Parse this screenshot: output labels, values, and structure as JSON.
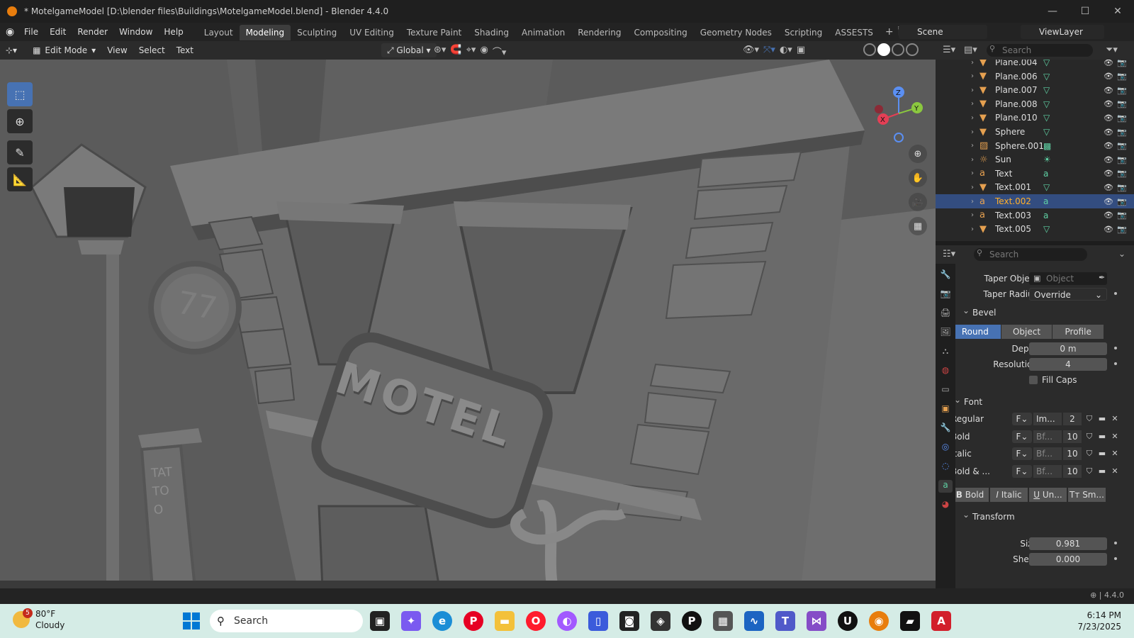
{
  "window": {
    "title": "* MotelgameModel [D:\\blender files\\Buildings\\MotelgameModel.blend] - Blender 4.4.0",
    "min": "—",
    "max": "☐",
    "close": "✕"
  },
  "menu": [
    "File",
    "Edit",
    "Render",
    "Window",
    "Help"
  ],
  "workspaces": [
    "Layout",
    "Modeling",
    "Sculpting",
    "UV Editing",
    "Texture Paint",
    "Shading",
    "Animation",
    "Rendering",
    "Compositing",
    "Geometry Nodes",
    "Scripting",
    "ASSESTS"
  ],
  "scene": "Scene",
  "viewlayer": "ViewLayer",
  "viewport_header": {
    "mode": "Edit Mode",
    "items": [
      "View",
      "Select",
      "Text"
    ],
    "orientation": "Global"
  },
  "outliner": {
    "search_placeholder": "Search",
    "rows": [
      {
        "name": "Plane.004",
        "icon": "mesh"
      },
      {
        "name": "Plane.006",
        "icon": "mesh"
      },
      {
        "name": "Plane.007",
        "icon": "mesh"
      },
      {
        "name": "Plane.008",
        "icon": "mesh"
      },
      {
        "name": "Plane.010",
        "icon": "mesh"
      },
      {
        "name": "Sphere",
        "icon": "mesh"
      },
      {
        "name": "Sphere.001",
        "icon": "lattice"
      },
      {
        "name": "Sun",
        "icon": "light"
      },
      {
        "name": "Text",
        "icon": "text"
      },
      {
        "name": "Text.001",
        "icon": "mesh"
      },
      {
        "name": "Text.002",
        "icon": "text",
        "selected": true
      },
      {
        "name": "Text.003",
        "icon": "text"
      },
      {
        "name": "Text.005",
        "icon": "mesh"
      }
    ]
  },
  "properties": {
    "search_placeholder": "Search",
    "taper_object_label": "Taper Object",
    "taper_object_placeholder": "Object",
    "taper_radius_label": "Taper Radius",
    "taper_radius_value": "Override",
    "bevel_header": "Bevel",
    "bevel_modes": [
      "Round",
      "Object",
      "Profile"
    ],
    "depth_label": "Depth",
    "depth_value": "0 m",
    "resolution_label": "Resolution",
    "resolution_value": "4",
    "fill_caps_label": "Fill Caps",
    "font_header": "Font",
    "fonts": [
      {
        "label": "Regular",
        "name": "Im...",
        "users": "2"
      },
      {
        "label": "Bold",
        "name": "Bf...",
        "users": "10"
      },
      {
        "label": "Italic",
        "name": "Bf...",
        "users": "10"
      },
      {
        "label": "Bold & ...",
        "name": "Bf...",
        "users": "10"
      }
    ],
    "style_buttons": [
      "Bold",
      "Italic",
      "Un...",
      "Sm..."
    ],
    "transform_header": "Transform",
    "size_label": "Size",
    "size_value": "0.981",
    "shear_label": "Shear",
    "shear_value": "0.000"
  },
  "viewport_text": {
    "motel": "MOTEL",
    "tattoo": "TATTOO",
    "number": "77"
  },
  "status": {
    "version": "4.4.0"
  },
  "taskbar": {
    "temp": "80°F",
    "condition": "Cloudy",
    "badge": "5",
    "search": "Search",
    "time": "6:14 PM",
    "date": "7/23/2025"
  }
}
